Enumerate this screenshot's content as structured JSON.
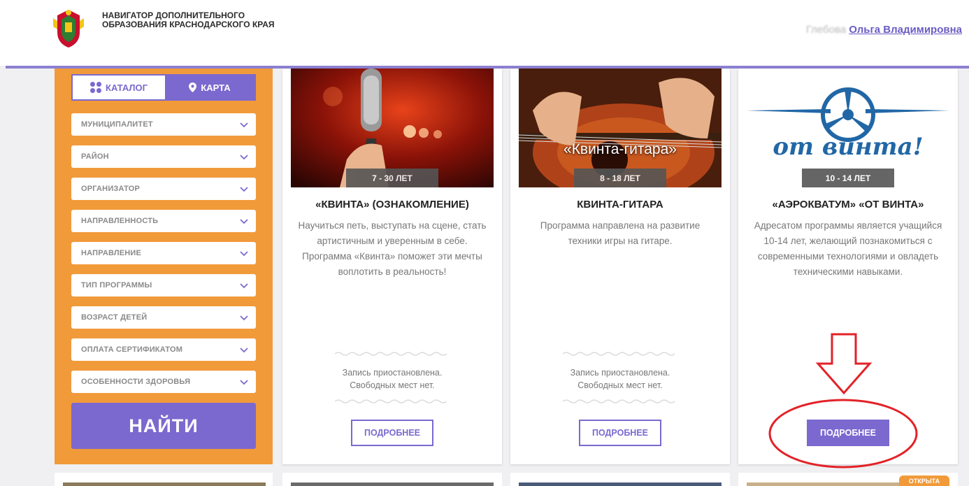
{
  "header": {
    "title": "НАВИГАТОР ДОПОЛНИТЕЛЬНОГО ОБРАЗОВАНИЯ КРАСНОДАРСКОГО КРАЯ",
    "user_surname": "Глебова",
    "user_name": "Ольга Владимировна"
  },
  "sidebar": {
    "tab_catalog": "КАТАЛОГ",
    "tab_map": "КАРТА",
    "filters": [
      "МУНИЦИПАЛИТЕТ",
      "РАЙОН",
      "ОРГАНИЗАТОР",
      "НАПРАВЛЕННОСТЬ",
      "НАПРАВЛЕНИЕ",
      "ТИП ПРОГРАММЫ",
      "ВОЗРАСТ ДЕТЕЙ",
      "ОПЛАТА СЕРТИФИКАТОМ",
      "ОСОБЕННОСТИ ЗДОРОВЬЯ"
    ],
    "find_label": "НАЙТИ"
  },
  "cards": [
    {
      "age": "7 - 30 ЛЕТ",
      "title": "«КВИНТА» (ОЗНАКОМЛЕНИЕ)",
      "description": "Научиться петь, выступать на сцене, стать артистичным и уверенным в себе. Программа «Квинта» поможет эти мечты воплотить в реальность!",
      "status_line1": "Запись приостановлена.",
      "status_line2": "Свободных мест нет.",
      "button": "ПОДРОБНЕЕ"
    },
    {
      "age": "8 - 18 ЛЕТ",
      "image_caption": "«Квинта-гитара»",
      "title": "КВИНТА-ГИТАРА",
      "description": "Программа направлена на развитие техники игры на гитаре.",
      "status_line1": "Запись приостановлена.",
      "status_line2": "Свободных мест нет.",
      "button": "ПОДРОБНЕЕ"
    },
    {
      "age": "10 - 14 ЛЕТ",
      "image_caption": "от винта!",
      "title": "«АЭРОКВАТУМ» «ОТ ВИНТА»",
      "description": "Адресатом программы является учащийся 10-14 лет, желающий познакомиться с современными технологиями и овладеть техническими навыками.",
      "button": "ПОДРОБНЕЕ"
    }
  ],
  "bottom_badge": "ОТКРЫТА",
  "colors": {
    "accent": "#7b69cf",
    "sidebar": "#f19a3a",
    "annotation": "#e32228"
  },
  "icons": [
    "coat-of-arms-logo",
    "grid-icon",
    "map-pin-icon",
    "chevron-down-icon",
    "arrow-down-annotation",
    "ellipse-annotation"
  ]
}
